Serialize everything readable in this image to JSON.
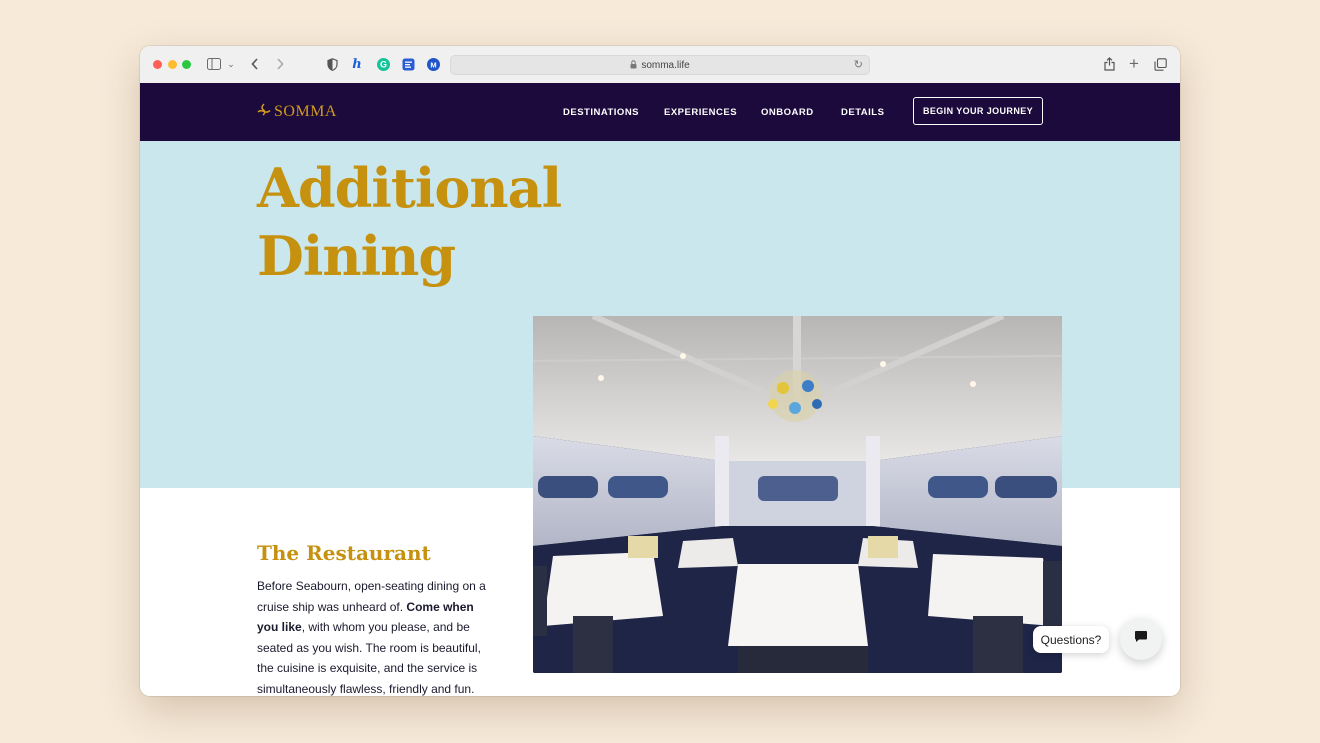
{
  "browser": {
    "url": "somma.life",
    "icons": [
      "sidebar-icon",
      "chevron-down-icon",
      "back-icon",
      "forward-icon",
      "shield-icon",
      "extension-icon",
      "grammarly-icon",
      "notes-icon",
      "mail-icon",
      "lock-icon",
      "reload-icon",
      "share-icon",
      "new-tab-icon",
      "tabs-overview-icon"
    ]
  },
  "site": {
    "logo": "SOMMA",
    "nav": [
      "DESTINATIONS",
      "EXPERIENCES",
      "ONBOARD",
      "DETAILS"
    ],
    "cta": "BEGIN YOUR JOURNEY"
  },
  "hero": {
    "title_line1": "Additional",
    "title_line2": "Dining"
  },
  "restaurant": {
    "heading": "The Restaurant",
    "text_1": "Before Seabourn, open-seating dining on a cruise ship was unheard of. ",
    "text_bold": "Come when you like",
    "text_2": ", with whom you please, and be seated as you wish. The room is beautiful, the cuisine is exquisite, and the service is simultaneously flawless, friendly and fun."
  },
  "chat": {
    "label": "Questions?"
  },
  "colors": {
    "nav_bg": "#1b0a3b",
    "accent_gold": "#c5910f",
    "hero_bg": "#c9e7ec",
    "page_bg": "#f7ead9"
  }
}
